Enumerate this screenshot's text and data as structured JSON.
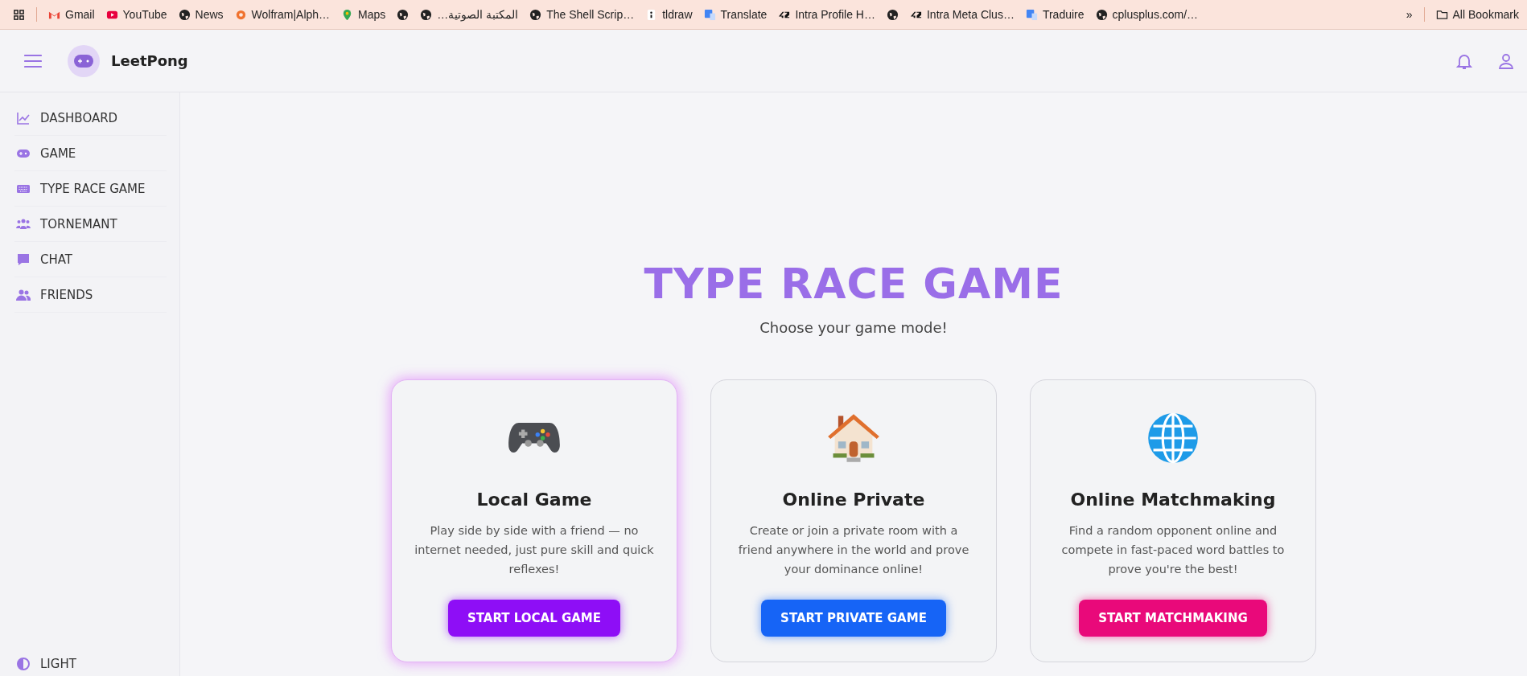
{
  "bookmarks_bar": {
    "items": [
      {
        "kind": "gmail",
        "label": "Gmail"
      },
      {
        "kind": "youtube",
        "label": "YouTube"
      },
      {
        "kind": "globe",
        "label": "News"
      },
      {
        "kind": "wolfram",
        "label": "Wolfram|Alph…"
      },
      {
        "kind": "maps",
        "label": "Maps"
      },
      {
        "kind": "globe"
      },
      {
        "kind": "globe",
        "label": "المكتبة الصوتية…"
      },
      {
        "kind": "globe",
        "label": "The Shell Scrip…"
      },
      {
        "kind": "tldraw",
        "label": "tldraw"
      },
      {
        "kind": "translate",
        "label": "Translate"
      },
      {
        "kind": "fortytwo",
        "label": "Intra Profile H…"
      },
      {
        "kind": "globe"
      },
      {
        "kind": "fortytwo",
        "label": "Intra Meta Clus…"
      },
      {
        "kind": "translate",
        "label": "Traduire"
      },
      {
        "kind": "globe",
        "label": "cplusplus.com/…"
      }
    ],
    "more": "»",
    "all_bookmarks": "All Bookmark"
  },
  "header": {
    "app_name": "LeetPong"
  },
  "sidebar": {
    "items": [
      {
        "kind": "chart",
        "label": "DASHBOARD"
      },
      {
        "kind": "gamepad",
        "label": "GAME"
      },
      {
        "kind": "keyboard",
        "label": "TYPE RACE GAME"
      },
      {
        "kind": "group",
        "label": "TORNEMANT"
      },
      {
        "kind": "chat",
        "label": "CHAT"
      },
      {
        "kind": "friends",
        "label": "FRIENDS"
      }
    ],
    "theme_toggle": "LIGHT"
  },
  "main": {
    "title": "TYPE RACE GAME",
    "subtitle": "Choose your game mode!",
    "cards": [
      {
        "kind": "gamepad",
        "title": "Local Game",
        "description": "Play side by side with a friend — no internet needed, just pure skill and quick reflexes!",
        "button": "START LOCAL GAME",
        "color": "#8e0ef6",
        "selected": true
      },
      {
        "kind": "house",
        "title": "Online Private",
        "description": "Create or join a private room with a friend anywhere in the world and prove your dominance online!",
        "button": "START PRIVATE GAME",
        "color": "#1664f6",
        "selected": false
      },
      {
        "kind": "globe",
        "title": "Online Matchmaking",
        "description": "Find a random opponent online and compete in fast-paced word battles to prove you're the best!",
        "button": "START MATCHMAKING",
        "color": "#e9097a",
        "selected": false
      }
    ]
  }
}
